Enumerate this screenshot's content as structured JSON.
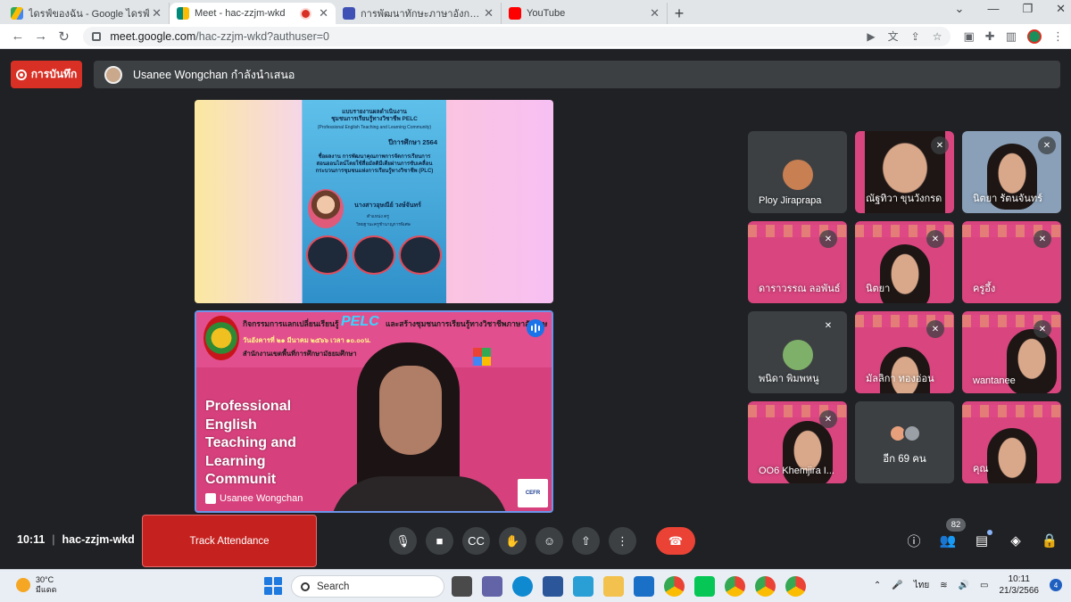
{
  "browser": {
    "tabs": [
      {
        "title": "ไดรฟ์ของฉัน - Google ไดรฟ์",
        "color": "#4285f4"
      },
      {
        "title": "Meet - hac-zzjm-wkd",
        "color": "#00897b"
      },
      {
        "title": "การพัฒนาทักษะภาษาอังกฤษ English",
        "color": "#3f51b5"
      },
      {
        "title": "YouTube",
        "color": "#ff0000"
      }
    ],
    "url_host": "meet.google.com",
    "url_path": "/hac-zzjm-wkd?authuser=0"
  },
  "meet": {
    "record_label": "การบันทึก",
    "presenter_text": "Usanee Wongchan กำลังนำเสนอ",
    "slide": {
      "title1": "แบบรายงานผลดำเนินงาน",
      "title2": "ชุมชนการเรียนรู้ทางวิชาชีพ PELC",
      "subtitle": "(Professional English Teaching and Learning Community)",
      "year": "ปีการศึกษา 2564",
      "project1": "ชื่อผลงาน การพัฒนาคุณภาพการจัดการเรียนการ",
      "project2": "สอนออนไลน์โดยใช้สื่อมัลติมีเดียผ่านการขับเคลื่อน",
      "project3": "กระบวนการชุมชนแห่งการเรียนรู้ทางวิชาชีพ (PLC)",
      "name": "นางสาวอุษณีย์  วงษ์จันทร์",
      "position": "ตำแหน่ง  ครู",
      "school": "วิทยฐานะครูชำนาญการพิเศษ"
    },
    "main_video": {
      "banner1": "กิจกรรมการแลกเปลี่ยนเรียนรู้",
      "banner_pelc": "PELC",
      "banner1b": "และสร้างชุมชนการเรียนรู้ทางวิชาชีพภาษาอังกฤษ",
      "banner2": "วันอังคารที่ ๒๑ มีนาคม ๒๕๖๖ เวลา ๑๐.๐๐น.",
      "banner3": "สำนักงานเขตพื้นที่การศึกษามัธยมศึกษา",
      "slide_text": "Professional English Teaching and Learning Communit",
      "name": "Usanee Wongchan",
      "cefr": "CEFR"
    },
    "participants": [
      {
        "name": "Ploy Jiraprapa",
        "muted": false,
        "video": false
      },
      {
        "name": "ณัฐทิวา ขุนวังกรด",
        "muted": true,
        "video": true
      },
      {
        "name": "นิตยา รัตนจันทร์",
        "muted": true,
        "video": true
      },
      {
        "name": "ดาราวรรณ ลอพันธ์",
        "muted": true,
        "video": true
      },
      {
        "name": "นิตยา",
        "muted": true,
        "video": true
      },
      {
        "name": "ครูอึ้ง",
        "muted": true,
        "video": true
      },
      {
        "name": "พนิดา พิมพหนู",
        "muted": true,
        "video": false
      },
      {
        "name": "มัลลิกา ทองอ่อน",
        "muted": true,
        "video": true
      },
      {
        "name": "wantanee",
        "muted": true,
        "video": true
      },
      {
        "name": "OO6 Khemjira I...",
        "muted": true,
        "video": true
      },
      {
        "name": "อีก 69 คน",
        "muted": false,
        "video": false
      },
      {
        "name": "คุณ",
        "muted": false,
        "video": true
      }
    ],
    "time": "10:11",
    "code": "hac-zzjm-wkd",
    "track_attendance": "Track Attendance",
    "people_count": "82"
  },
  "taskbar": {
    "temp": "30°C",
    "weather": "มีแดด",
    "search": "Search",
    "lang": "ไทย",
    "time": "10:11",
    "date": "21/3/2566",
    "notif": "4"
  }
}
